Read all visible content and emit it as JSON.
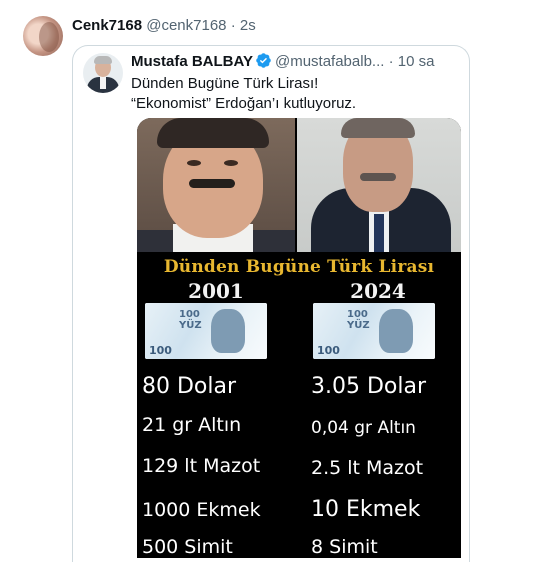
{
  "outer_tweet": {
    "author_name": "Cenk7168",
    "handle": "@cenk7168",
    "separator": "·",
    "time": "2s"
  },
  "quoted_tweet": {
    "author_name": "Mustafa BALBAY",
    "handle": "@mustafabalb...",
    "separator": "·",
    "time": "10 sa",
    "lines": [
      "Dünden Bugüne Türk Lirası!",
      "“Ekonomist” Erdoğan’ı kutluyoruz."
    ],
    "verified_color": "#1d9bf0"
  },
  "image": {
    "title": "Dünden Bugüne Türk Lirası",
    "year_left": "2001",
    "year_right": "2024",
    "banknote_label": "100",
    "banknote_text": "YÜZ",
    "left_values": [
      "80 Dolar",
      "21 gr Altın",
      "129 lt Mazot",
      "1000 Ekmek",
      "500 Simit"
    ],
    "right_values": [
      "3.05 Dolar",
      "0,04 gr Altın",
      "2.5 lt Mazot",
      "10 Ekmek",
      "8 Simit"
    ],
    "title_color": "#e8b730"
  }
}
